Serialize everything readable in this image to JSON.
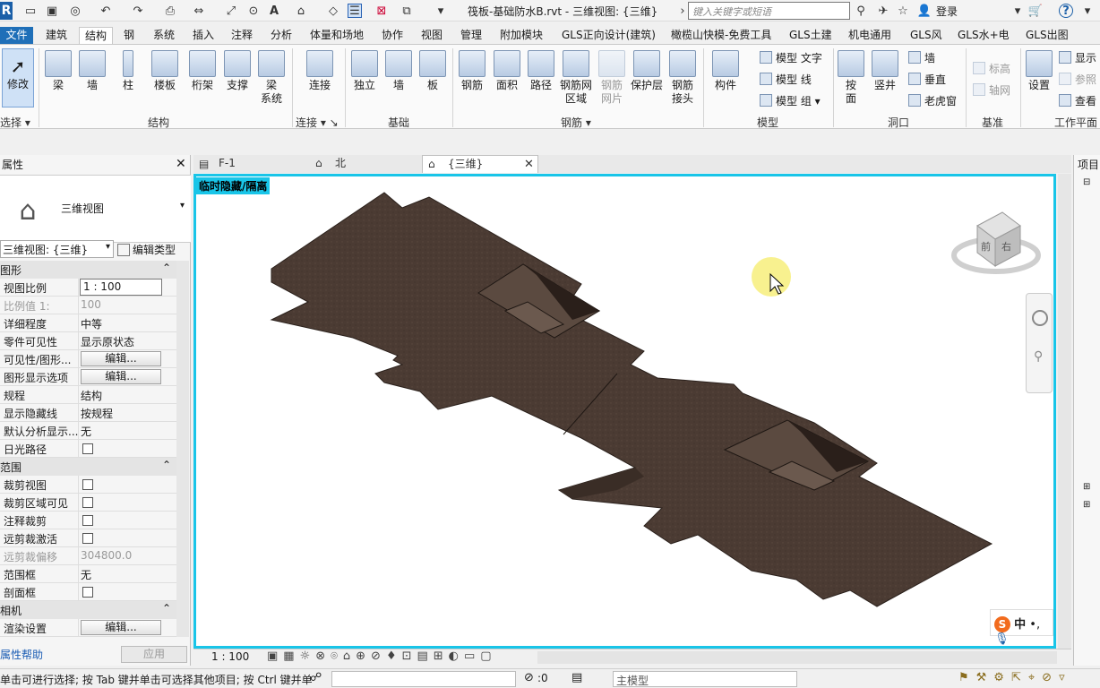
{
  "titlebar": {
    "app_letter": "R",
    "doc_title": "筏板-基础防水B.rvt - 三维视图: {三维}",
    "search_placeholder": "键入关键字或短语",
    "login": "登录"
  },
  "menu_tabs": [
    "文件",
    "建筑",
    "结构",
    "钢",
    "系统",
    "插入",
    "注释",
    "分析",
    "体量和场地",
    "协作",
    "视图",
    "管理",
    "附加模块",
    "GLS正向设计(建筑)",
    "橄榄山快模-免费工具",
    "GLS土建",
    "机电通用",
    "GLS风",
    "GLS水+电",
    "GLS出图"
  ],
  "active_tab": "结构",
  "ribbon": {
    "modify": "修改",
    "select": "选择",
    "structure_items": [
      "梁",
      "墙",
      "柱",
      "楼板",
      "桁架",
      "支撑",
      "梁\n系统"
    ],
    "structure_label": "结构",
    "connection_item": "连接",
    "connection_label": "连接",
    "foundation_items": [
      "独立",
      "墙",
      "板"
    ],
    "foundation_label": "基础",
    "rebar_items": [
      "钢筋",
      "面积",
      "路径",
      "钢筋网\n区域",
      "钢筋\n网片",
      "保护层",
      "钢筋\n接头"
    ],
    "rebar_label": "钢筋",
    "component": "构件",
    "model_items": [
      "模型 文字",
      "模型 线",
      "模型 组"
    ],
    "model_label": "模型",
    "opening_items": [
      "按\n面",
      "竖井"
    ],
    "opening_small": [
      "墙",
      "垂直",
      "老虎窗"
    ],
    "opening_label": "洞口",
    "datum_items": [
      "标高",
      "轴网"
    ],
    "datum_label": "基准",
    "setting": "设置",
    "workplane_items": [
      "显示",
      "参照",
      "查看"
    ],
    "workplane_label": "工作平面"
  },
  "properties": {
    "header": "属性",
    "type_name": "三维视图",
    "view_selector": "三维视图: {三维}",
    "edit_type": "编辑类型",
    "sections": [
      {
        "title": "图形",
        "rows": [
          {
            "k": "视图比例",
            "v": "1 : 100"
          },
          {
            "k": "比例值 1:",
            "v": "100"
          },
          {
            "k": "详细程度",
            "v": "中等"
          },
          {
            "k": "零件可见性",
            "v": "显示原状态"
          },
          {
            "k": "可见性/图形...",
            "v": "编辑..."
          },
          {
            "k": "图形显示选项",
            "v": "编辑..."
          },
          {
            "k": "规程",
            "v": "结构"
          },
          {
            "k": "显示隐藏线",
            "v": "按规程"
          },
          {
            "k": "默认分析显示...",
            "v": "无"
          },
          {
            "k": "日光路径",
            "v": ""
          }
        ]
      },
      {
        "title": "范围",
        "rows": [
          {
            "k": "裁剪视图",
            "v": ""
          },
          {
            "k": "裁剪区域可见",
            "v": ""
          },
          {
            "k": "注释裁剪",
            "v": ""
          },
          {
            "k": "远剪裁激活",
            "v": ""
          },
          {
            "k": "远剪裁偏移",
            "v": "304800.0"
          },
          {
            "k": "范围框",
            "v": "无"
          },
          {
            "k": "剖面框",
            "v": ""
          }
        ]
      },
      {
        "title": "相机",
        "rows": [
          {
            "k": "渲染设置",
            "v": "编辑..."
          }
        ]
      }
    ],
    "help_link": "属性帮助",
    "apply": "应用"
  },
  "view_tabs": [
    "F-1",
    "北",
    "{三维}"
  ],
  "iso_label": "临时隐藏/隔离",
  "viewcube": {
    "front": "前",
    "right": "右"
  },
  "viewbar_scale": "1 : 100",
  "status": {
    "hint": "单击可进行选择; 按 Tab 键并单击可选择其他项目; 按 Ctrl 键并单",
    "count": ":0",
    "model": "主模型"
  },
  "project_browser": "项目",
  "ime": {
    "lang": "中"
  },
  "colors": {
    "accent": "#19c5e8",
    "file_tab": "#1f6fb8",
    "slab": "#4b3b33"
  }
}
